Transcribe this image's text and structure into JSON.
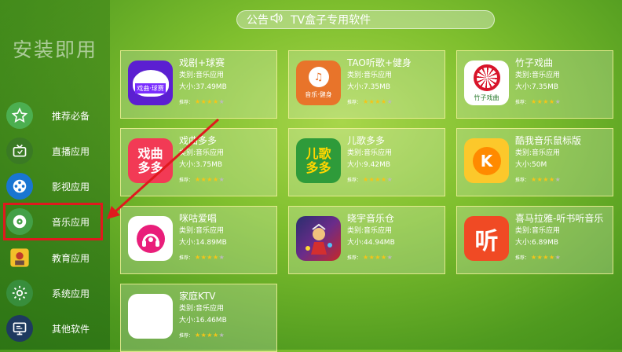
{
  "announcement": {
    "label": "公告",
    "text": "TV盒子专用软件"
  },
  "sidebar": {
    "title": "安装即用",
    "items": [
      {
        "label": "推荐必备",
        "icon": "star-icon",
        "color": "#4caf50"
      },
      {
        "label": "直播应用",
        "icon": "tv-icon",
        "color": "#3a7a24"
      },
      {
        "label": "影视应用",
        "icon": "film-reel-icon",
        "color": "#1976d2"
      },
      {
        "label": "音乐应用",
        "icon": "music-disc-icon",
        "color": "#43a047"
      },
      {
        "label": "教育应用",
        "icon": "education-icon",
        "color": "#ef6c00"
      },
      {
        "label": "系统应用",
        "icon": "gear-icon",
        "color": "#388e3c"
      },
      {
        "label": "其他软件",
        "icon": "monitor-icon",
        "color": "#1e3a5f"
      }
    ],
    "selected": "音乐应用"
  },
  "rating_label": "推荐：",
  "apps": [
    {
      "name": "戏剧+球赛",
      "category": "类别:音乐应用",
      "size": "大小:37.49MB",
      "stars": 4,
      "icon": "opera-ball-icon",
      "color": "#5b1fd1",
      "glyph": "戏曲·球赛"
    },
    {
      "name": "TAO听歌+健身",
      "category": "类别:音乐应用",
      "size": "大小:7.35MB",
      "stars": 4,
      "icon": "tao-music-icon",
      "color": "#e8742a",
      "glyph": "音乐·健身"
    },
    {
      "name": "竹子戏曲",
      "category": "类别:音乐应用",
      "size": "大小:7.35MB",
      "stars": 4,
      "icon": "bamboo-opera-icon",
      "color": "#ffffff",
      "glyph": "竹子戏曲"
    },
    {
      "name": "戏曲多多",
      "category": "类别:音乐应用",
      "size": "大小:3.75MB",
      "stars": 4,
      "icon": "opera-duoduo-icon",
      "color": "#f23a55",
      "glyph": "戏曲多多"
    },
    {
      "name": "儿歌多多",
      "category": "类别:音乐应用",
      "size": "大小:9.42MB",
      "stars": 4,
      "icon": "kids-songs-icon",
      "color": "#2e9b3a",
      "glyph": "儿歌多多"
    },
    {
      "name": "酷我音乐鼠标版",
      "category": "类别:音乐应用",
      "size": "大小:50M",
      "stars": 4,
      "icon": "kuwo-music-icon",
      "color": "#fcc82b",
      "glyph": "K"
    },
    {
      "name": "咪咕爱唱",
      "category": "类别:音乐应用",
      "size": "大小:14.89MB",
      "stars": 4,
      "icon": "migu-sing-icon",
      "color": "#ffffff",
      "glyph": ""
    },
    {
      "name": "晓宇音乐仓",
      "category": "类别:音乐应用",
      "size": "大小:44.94MB",
      "stars": 4,
      "icon": "xiaoyu-music-icon",
      "color": "#2a2e6e",
      "glyph": ""
    },
    {
      "name": "喜马拉雅-听书听音乐",
      "category": "类别:音乐应用",
      "size": "大小:6.89MB",
      "stars": 4,
      "icon": "ximalaya-icon",
      "color": "#f04a24",
      "glyph": "听"
    },
    {
      "name": "家庭KTV",
      "category": "类别:音乐应用",
      "size": "大小:16.46MB",
      "stars": 4,
      "icon": "family-ktv-icon",
      "color": "#ffffff",
      "glyph": ""
    }
  ]
}
